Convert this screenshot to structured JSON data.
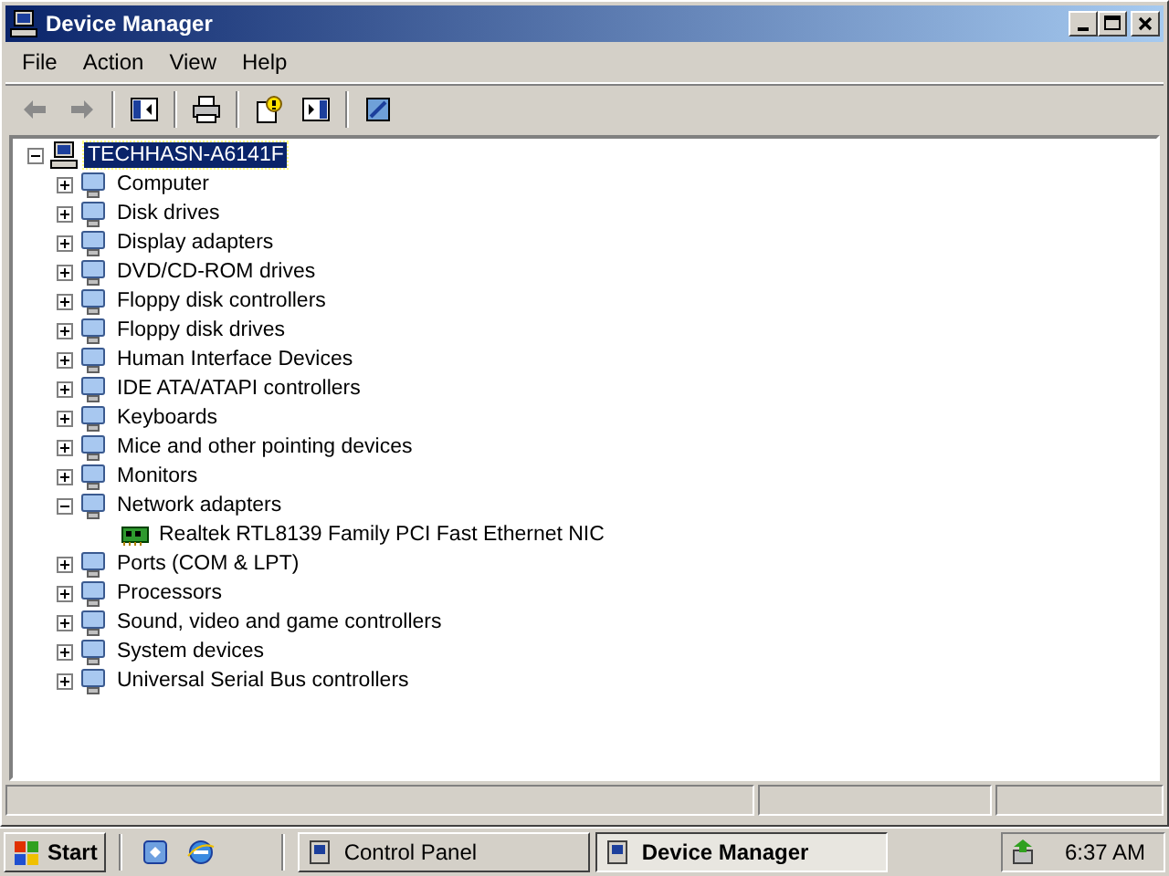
{
  "window": {
    "title": "Device Manager"
  },
  "menu": [
    "File",
    "Action",
    "View",
    "Help"
  ],
  "tree": {
    "label": "TECHHASN-A6141F",
    "selected": true,
    "expanded": true,
    "children": [
      {
        "label": "Computer",
        "expanded": false
      },
      {
        "label": "Disk drives",
        "expanded": false
      },
      {
        "label": "Display adapters",
        "expanded": false
      },
      {
        "label": "DVD/CD-ROM drives",
        "expanded": false
      },
      {
        "label": "Floppy disk controllers",
        "expanded": false
      },
      {
        "label": "Floppy disk drives",
        "expanded": false
      },
      {
        "label": "Human Interface Devices",
        "expanded": false
      },
      {
        "label": "IDE ATA/ATAPI controllers",
        "expanded": false
      },
      {
        "label": "Keyboards",
        "expanded": false
      },
      {
        "label": "Mice and other pointing devices",
        "expanded": false
      },
      {
        "label": "Monitors",
        "expanded": false
      },
      {
        "label": "Network adapters",
        "expanded": true,
        "children": [
          {
            "label": "Realtek RTL8139 Family PCI Fast Ethernet NIC"
          }
        ]
      },
      {
        "label": "Ports (COM & LPT)",
        "expanded": false
      },
      {
        "label": "Processors",
        "expanded": false
      },
      {
        "label": "Sound, video and game controllers",
        "expanded": false
      },
      {
        "label": "System devices",
        "expanded": false
      },
      {
        "label": "Universal Serial Bus controllers",
        "expanded": false
      }
    ]
  },
  "taskbar": {
    "start": "Start",
    "tasks": [
      {
        "label": "Control Panel",
        "selected": false
      },
      {
        "label": "Device Manager",
        "selected": true
      }
    ],
    "clock": "6:37 AM"
  }
}
